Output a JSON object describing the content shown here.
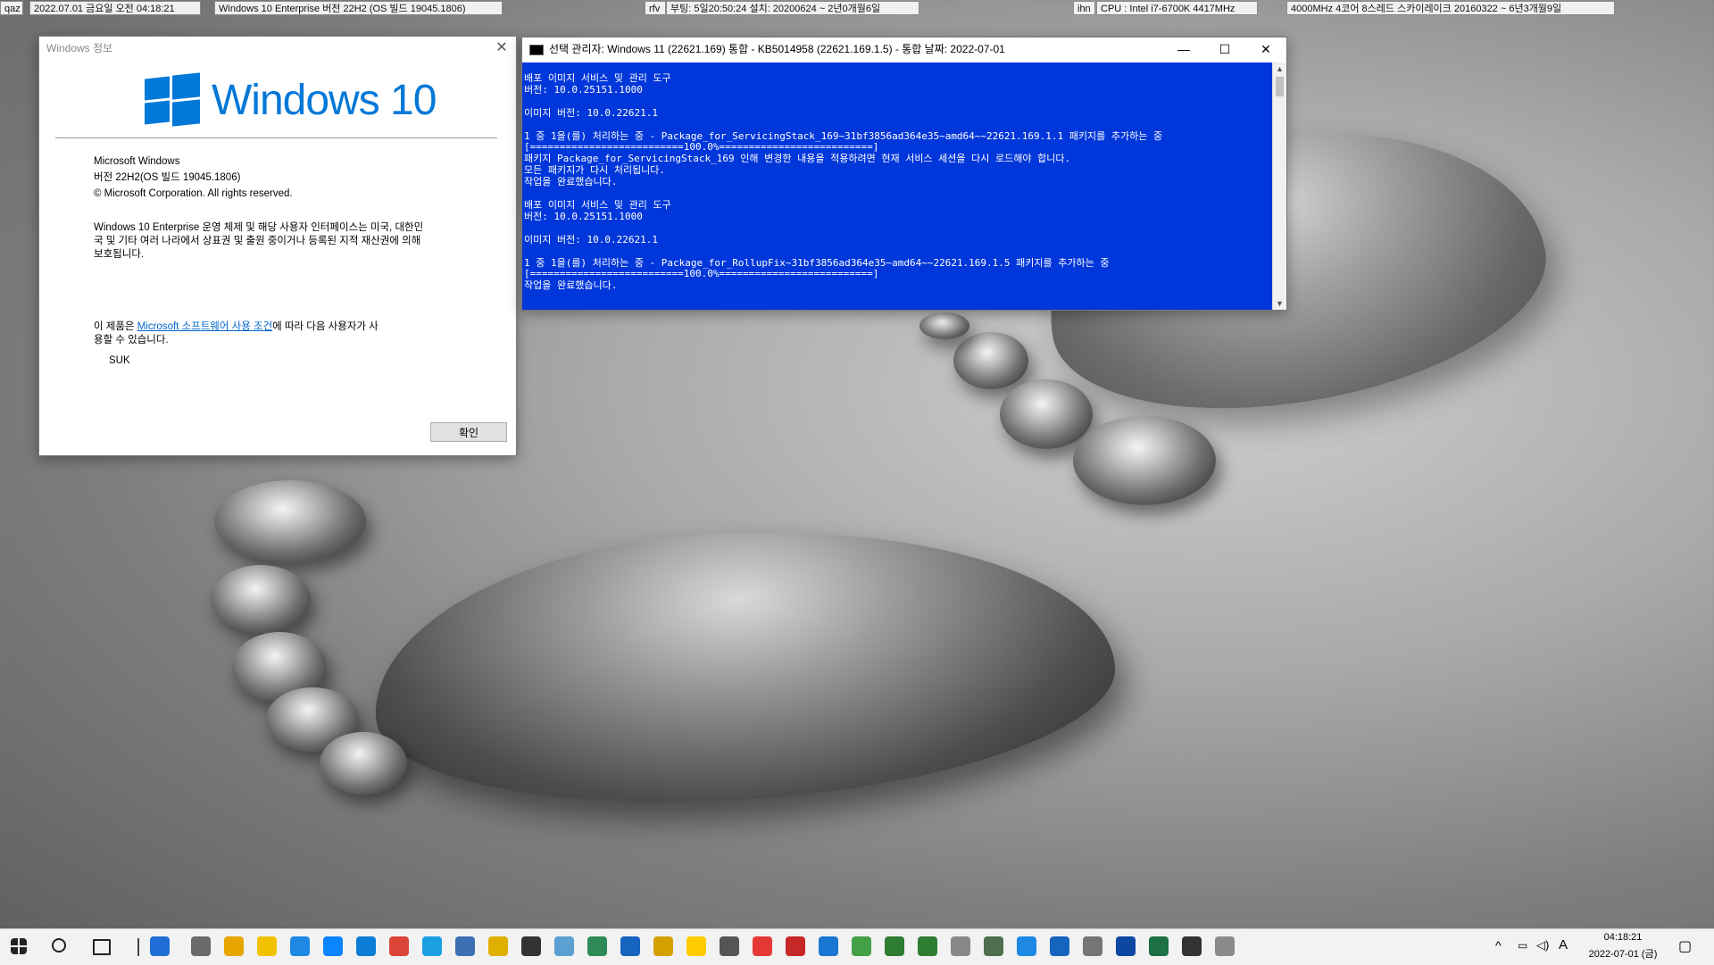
{
  "topbar": [
    {
      "label": "qaz"
    },
    {
      "label": "2022.07.01 금요일 오전 04:18:21"
    },
    {
      "label": "Windows 10 Enterprise 버전 22H2 (OS 빌드 19045.1806)"
    },
    {
      "label": "rfv"
    },
    {
      "label": "부팅: 5일20:50:24 설치: 20200624 ~ 2년0개월6일"
    },
    {
      "label": "ihn"
    },
    {
      "label": "CPU : Intel i7-6700K 4417MHz"
    },
    {
      "label": "4000MHz 4코어 8스레드 스카이레이크 20160322 ~ 6년3개월9일"
    }
  ],
  "about": {
    "title": "Windows 정보",
    "logo_text": "Windows 10",
    "product": "Microsoft Windows",
    "version": "버전 22H2(OS 빌드 19045.1806)",
    "copyright": "© Microsoft Corporation. All rights reserved.",
    "desc1": "Windows 10 Enterprise 운영 체제 및 해당 사용자 인터페이스는 미국, 대한민",
    "desc2": "국 및 기타 여러 나라에서 상표권 및 출원 중이거나 등록된 지적 재산권에 의해",
    "desc3": "보호됩니다.",
    "license_pre": "이 제품은 ",
    "license_link": "Microsoft 소프트웨어 사용 조건",
    "license_post": "에 따라 다음 사용자가 사",
    "license2": "용할 수 있습니다.",
    "user": "SUK",
    "ok": "확인"
  },
  "cmd": {
    "title": "선택 관리자:  Windows 11 (22621.169) 통합 - KB5014958 (22621.169.1.5) - 통합 날짜: 2022-07-01",
    "minimize": "—",
    "maximize": "☐",
    "close": "✕",
    "lines": [
      "배포 이미지 서비스 및 관리 도구",
      "버전: 10.0.25151.1000",
      "",
      "이미지 버전: 10.0.22621.1",
      "",
      "1 중 1을(를) 처리하는 중 - Package_for_ServicingStack_169~31bf3856ad364e35~amd64~~22621.169.1.1 패키지를 추가하는 중",
      "[==========================100.0%==========================]",
      "패키지 Package_for_ServicingStack_169 인해 변경한 내용을 적용하려면 현재 서비스 세션을 다시 로드해야 합니다.",
      "모든 패키지가 다시 처리됩니다.",
      "작업을 완료했습니다.",
      "",
      "배포 이미지 서비스 및 관리 도구",
      "버전: 10.0.25151.1000",
      "",
      "이미지 버전: 10.0.22621.1",
      "",
      "1 중 1을(를) 처리하는 중 - Package_for_RollupFix~31bf3856ad364e35~amd64~~22621.169.1.5 패키지를 추가하는 중",
      "[==========================100.0%==========================]",
      "작업을 완료했습니다."
    ]
  },
  "taskbar": {
    "clock_time": "04:18:21",
    "clock_date": "2022-07-01 (금)",
    "ime": "A",
    "icons": [
      "start-icon",
      "search-icon",
      "task-view-icon",
      "divider",
      "computer-icon",
      "tools-icon",
      "folder-icon",
      "sticky-notes-icon",
      "info-icon",
      "window-icon",
      "edge-icon",
      "chrome-icon",
      "ie-icon",
      "virtualbox-icon",
      "star-icon",
      "camera-icon",
      "paint-icon",
      "shield-icon",
      "monitor-icon",
      "chart-icon",
      "player-icon",
      "media-icon",
      "record-icon",
      "app-red-icon",
      "bear-icon",
      "map-icon",
      "app-green-icon",
      "globe-icon",
      "refresh-icon",
      "network-icon",
      "ftp-icon",
      "gear-icon",
      "notepad-icon",
      "excel-icon",
      "disc-icon",
      "plane-icon",
      "graph-icon"
    ],
    "colors": {
      "accent": "#0078d7",
      "console_bg": "#0037da"
    }
  }
}
